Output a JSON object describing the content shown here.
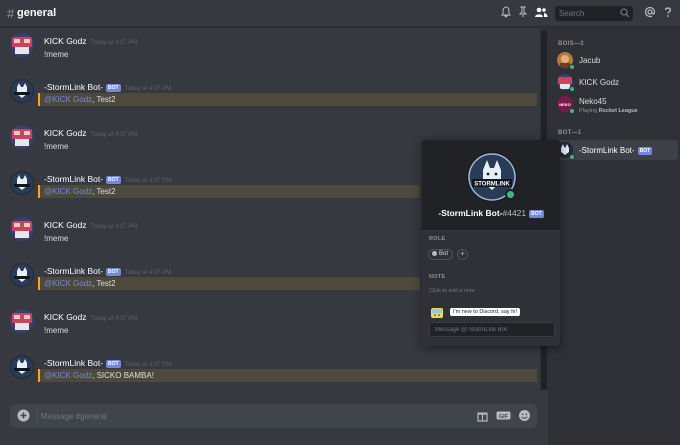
{
  "header": {
    "hash": "#",
    "channel_name": "general",
    "search_placeholder": "Search",
    "icons": [
      "bell-icon",
      "pin-icon",
      "members-icon",
      "search-icon",
      "at-icon",
      "help-icon"
    ]
  },
  "users": {
    "kick": {
      "name": "KICK Godz"
    },
    "bot": {
      "name": "-StormLink Bot-",
      "tag": "BOT"
    }
  },
  "messages": [
    {
      "author": "KICK Godz",
      "timestamp": "Today at 4:37 PM",
      "content": "!meme"
    },
    {
      "author": "-StormLink Bot-",
      "bot_tag": "BOT",
      "timestamp": "Today at 4:37 PM",
      "mention": "@KICK Godz",
      "content": ", Test2"
    },
    {
      "author": "KICK Godz",
      "timestamp": "Today at 4:37 PM",
      "content": "!meme"
    },
    {
      "author": "-StormLink Bot-",
      "bot_tag": "BOT",
      "timestamp": "Today at 4:37 PM",
      "mention": "@KICK Godz",
      "content": ", Test2"
    },
    {
      "author": "KICK Godz",
      "timestamp": "Today at 4:37 PM",
      "content": "!meme"
    },
    {
      "author": "-StormLink Bot-",
      "bot_tag": "BOT",
      "timestamp": "Today at 4:37 PM",
      "mention": "@KICK Godz",
      "content": ", Test2"
    },
    {
      "author": "KICK Godz",
      "timestamp": "Today at 4:37 PM",
      "content": "!meme"
    },
    {
      "author": "-StormLink Bot-",
      "bot_tag": "BOT",
      "timestamp": "Today at 4:37 PM",
      "mention": "@KICK Godz",
      "content": ", SICKO BAMBA!"
    }
  ],
  "composer": {
    "placeholder": "Message #general",
    "icons": [
      "add-icon",
      "gift-icon",
      "gif-icon",
      "emoji-icon"
    ],
    "gif_label": "GIF"
  },
  "members": {
    "groups": [
      {
        "label": "BOIS—3",
        "items": [
          {
            "name": "Jacub",
            "status": "online"
          },
          {
            "name": "KICK Godz",
            "status": "online"
          },
          {
            "name": "Neko45",
            "status": "online",
            "activity_prefix": "Playing ",
            "activity": "Rocket League",
            "avatar_text": "NEKO"
          }
        ]
      },
      {
        "label": "BOT—1",
        "items": [
          {
            "name": "-StormLink Bot-",
            "tag": "BOT",
            "status": "online",
            "selected": true
          }
        ]
      }
    ]
  },
  "popout": {
    "name": "-StormLink Bot-",
    "discriminator": "#4421",
    "tag": "BOT",
    "avatar_text": "STORMLINK",
    "role_label": "ROLE",
    "role_name": "Bot",
    "add_role": "+",
    "note_label": "NOTE",
    "note_placeholder": "Click to add a note",
    "wave_text": "I'm new to Discord, say hi!",
    "message_placeholder": "Message @-StormLink Bot-"
  },
  "colors": {
    "background": "#36393f",
    "sidebar": "#2f3136",
    "blurple": "#7289da",
    "mention_highlight": "#faa61a",
    "online": "#43b581"
  }
}
